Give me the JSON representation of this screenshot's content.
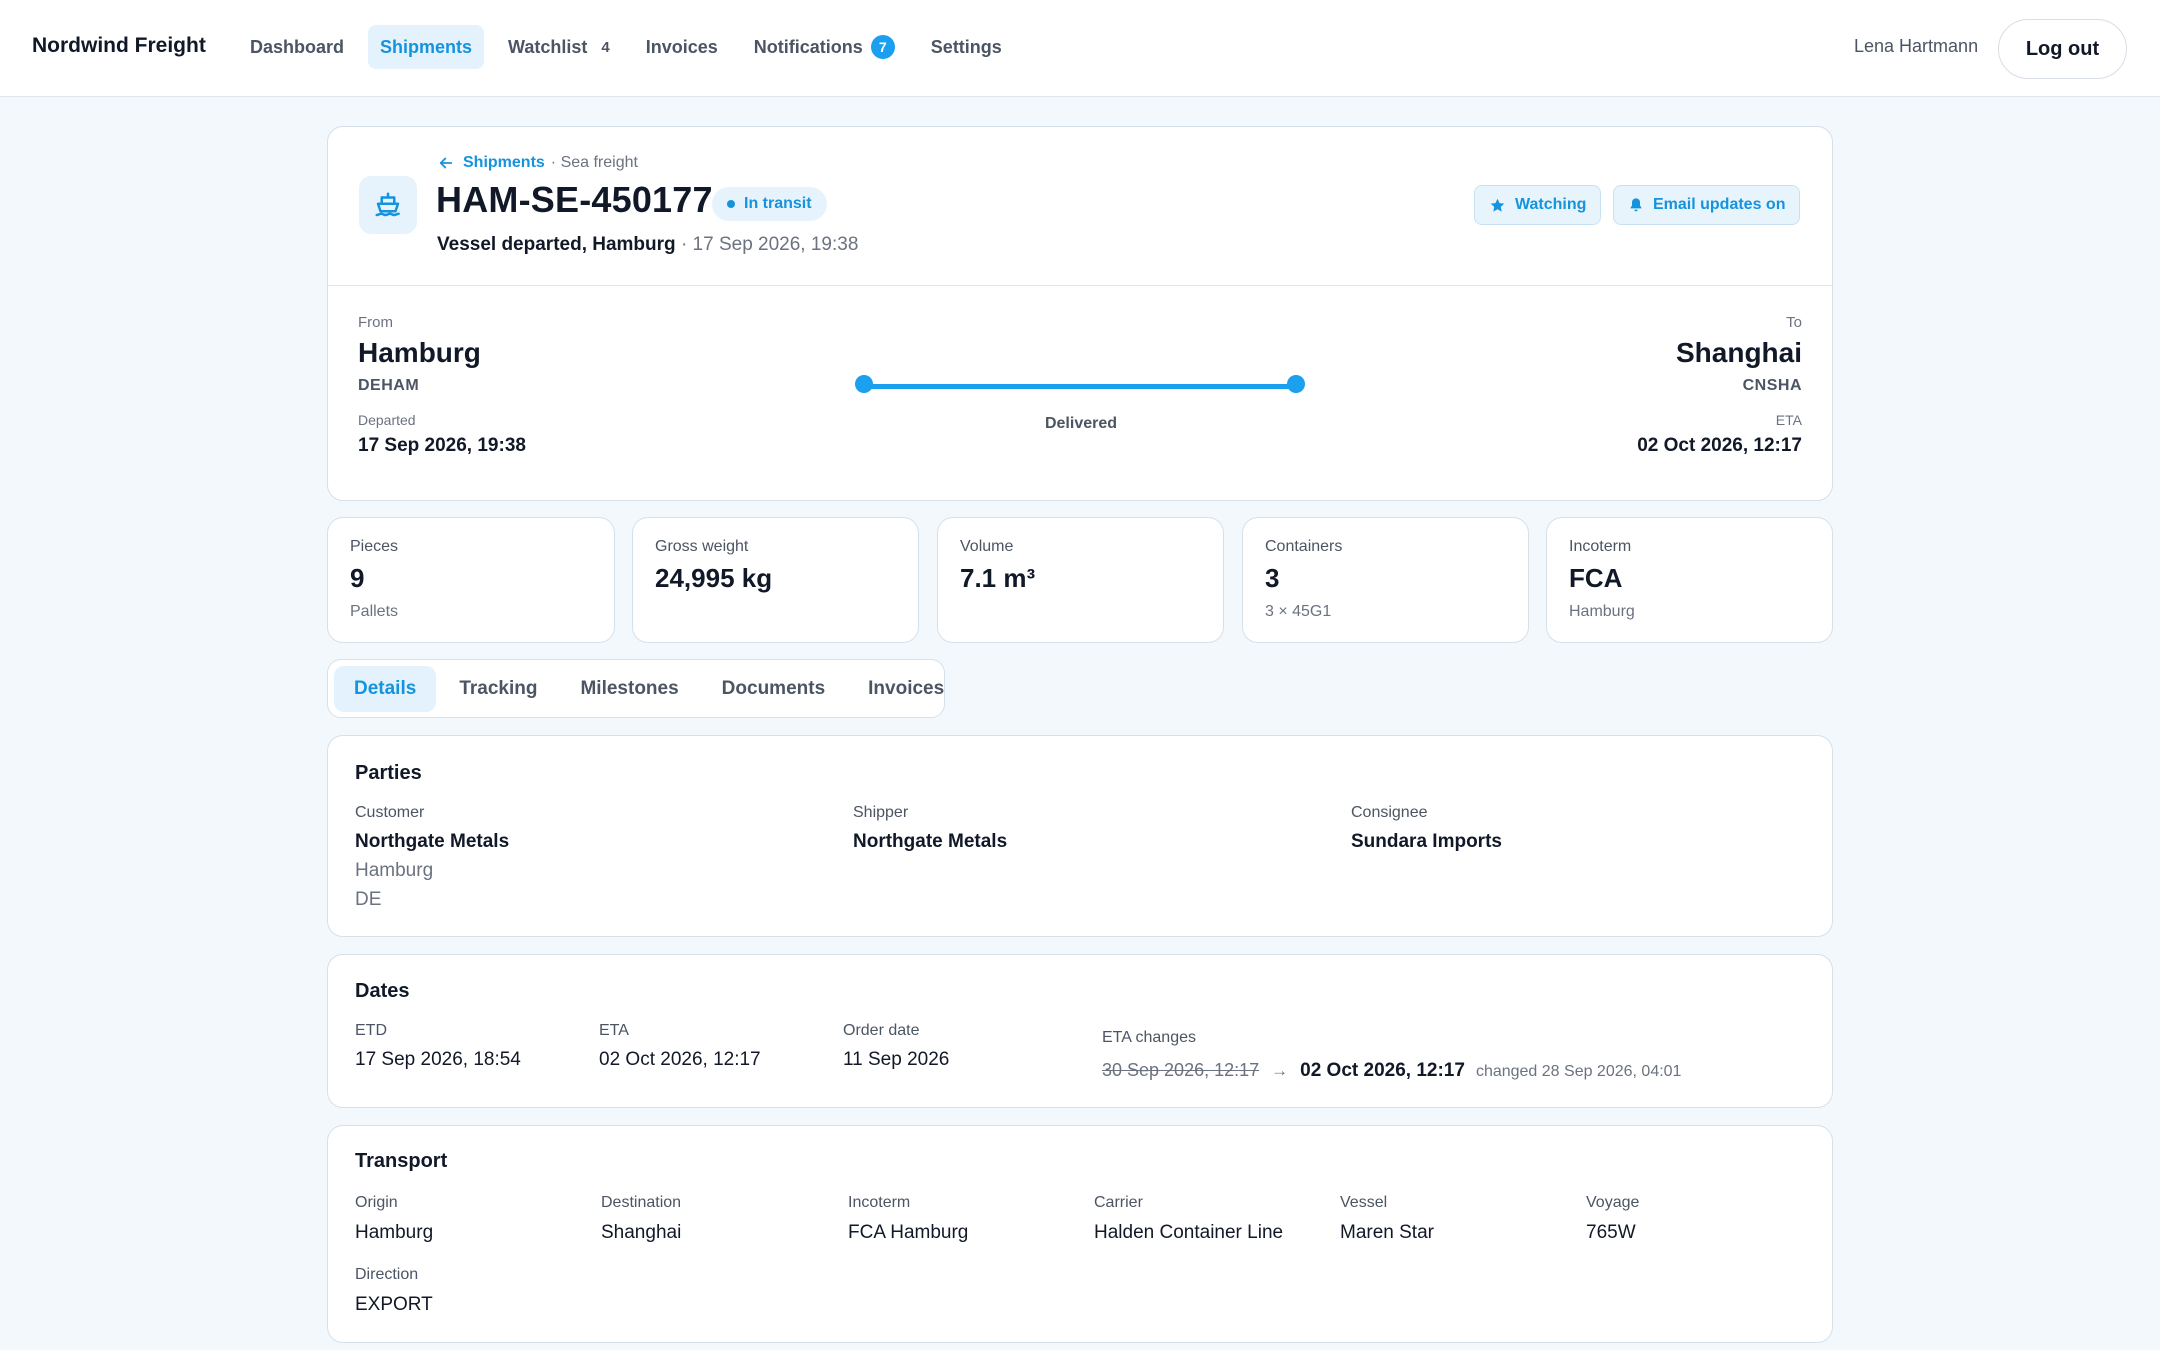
{
  "app": {
    "brand": "Nordwind Freight",
    "nav": {
      "dashboard": "Dashboard",
      "shipments": "Shipments",
      "watchlist": "Watchlist",
      "watchlist_count": "4",
      "invoices": "Invoices",
      "notifications": "Notifications",
      "notifications_count": "7",
      "settings": "Settings"
    },
    "user": "Lena Hartmann",
    "logout": "Log out"
  },
  "colors": {
    "accent": "#1aa0ee",
    "accent_text": "#1593dd",
    "accent_bg": "#e3f2fc",
    "page_bg": "#f3f8fc"
  },
  "shipment": {
    "breadcrumb_link": "Shipments",
    "breadcrumb_mode": "· Sea freight",
    "id": "HAM-SE-450177",
    "status": "In transit",
    "latest_event": "Vessel departed, Hamburg",
    "latest_event_time": "· 17 Sep 2026, 19:38",
    "watch_label": "Watching",
    "email_label": "Email updates on",
    "icon": "ship-icon"
  },
  "route": {
    "from_label": "From",
    "from_city": "Hamburg",
    "from_code": "DEHAM",
    "departed_label": "Departed",
    "departed_date": "17 Sep 2026, 19:38",
    "to_label": "To",
    "to_city": "Shanghai",
    "to_code": "CNSHA",
    "eta_label": "ETA",
    "eta_date": "02 Oct 2026, 12:17",
    "progress_label": "Delivered",
    "progress": 1.0
  },
  "stats": [
    {
      "label": "Pieces",
      "value": "9",
      "sub": "Pallets"
    },
    {
      "label": "Gross weight",
      "value": "24,995 kg",
      "sub": ""
    },
    {
      "label": "Volume",
      "value": "7.1 m³",
      "sub": ""
    },
    {
      "label": "Containers",
      "value": "3",
      "sub": "3 × 45G1"
    },
    {
      "label": "Incoterm",
      "value": "FCA",
      "sub": "Hamburg"
    }
  ],
  "tabs": [
    "Details",
    "Tracking",
    "Milestones",
    "Documents",
    "Invoices"
  ],
  "parties": {
    "title": "Parties",
    "customer_label": "Customer",
    "customer_name": "Northgate Metals",
    "customer_city": "Hamburg",
    "customer_country": "DE",
    "shipper_label": "Shipper",
    "shipper_name": "Northgate Metals",
    "consignee_label": "Consignee",
    "consignee_name": "Sundara Imports"
  },
  "dates": {
    "title": "Dates",
    "etd_label": "ETD",
    "etd": "17 Sep 2026, 18:54",
    "eta_label": "ETA",
    "eta": "02 Oct 2026, 12:17",
    "order_label": "Order date",
    "order": "11 Sep 2026",
    "changes_label": "ETA changes",
    "change_old": "30 Sep 2026, 12:17",
    "change_arrow": "→",
    "change_new": "02 Oct 2026, 12:17",
    "change_when": "changed 28 Sep 2026, 04:01"
  },
  "transport": {
    "title": "Transport",
    "origin_label": "Origin",
    "origin": "Hamburg",
    "destination_label": "Destination",
    "destination": "Shanghai",
    "incoterm_label": "Incoterm",
    "incoterm": "FCA Hamburg",
    "carrier_label": "Carrier",
    "carrier": "Halden Container Line",
    "vessel_label": "Vessel",
    "vessel": "Maren Star",
    "voyage_label": "Voyage",
    "voyage": "765W",
    "direction_label": "Direction",
    "direction": "EXPORT"
  }
}
